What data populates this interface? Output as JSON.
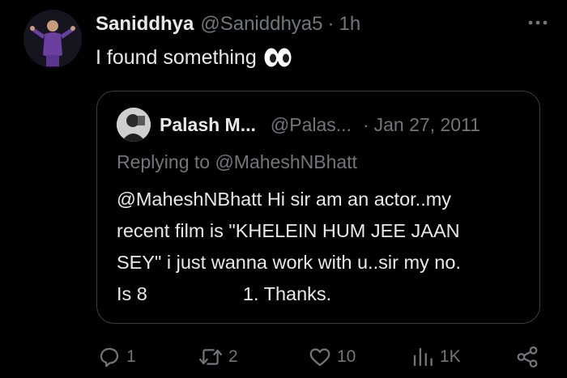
{
  "tweet": {
    "author_name": "Saniddhya",
    "author_handle": "@Saniddhya5",
    "separator": "·",
    "time": "1h",
    "text": "I found something",
    "emoji_icon": "eyes-icon"
  },
  "quoted_tweet": {
    "author_name": "Palash M...",
    "author_handle": "@Palas...",
    "separator": "·",
    "date": "Jan 27, 2011",
    "replying_to": "Replying to @MaheshNBhatt",
    "body_lines": [
      "@MaheshNBhatt Hi sir am an actor..my",
      "recent film is \"KHELEIN HUM JEE JAAN",
      "SEY\" i just wanna work with u..sir my no.",
      "Is 8",
      "1. Thanks."
    ]
  },
  "actions": {
    "replies": "1",
    "retweets": "2",
    "likes": "10",
    "views": "1K"
  },
  "colors": {
    "background": "#000000",
    "text_primary": "#e7e9ea",
    "text_secondary": "#71767b",
    "border": "#3a3d41"
  }
}
